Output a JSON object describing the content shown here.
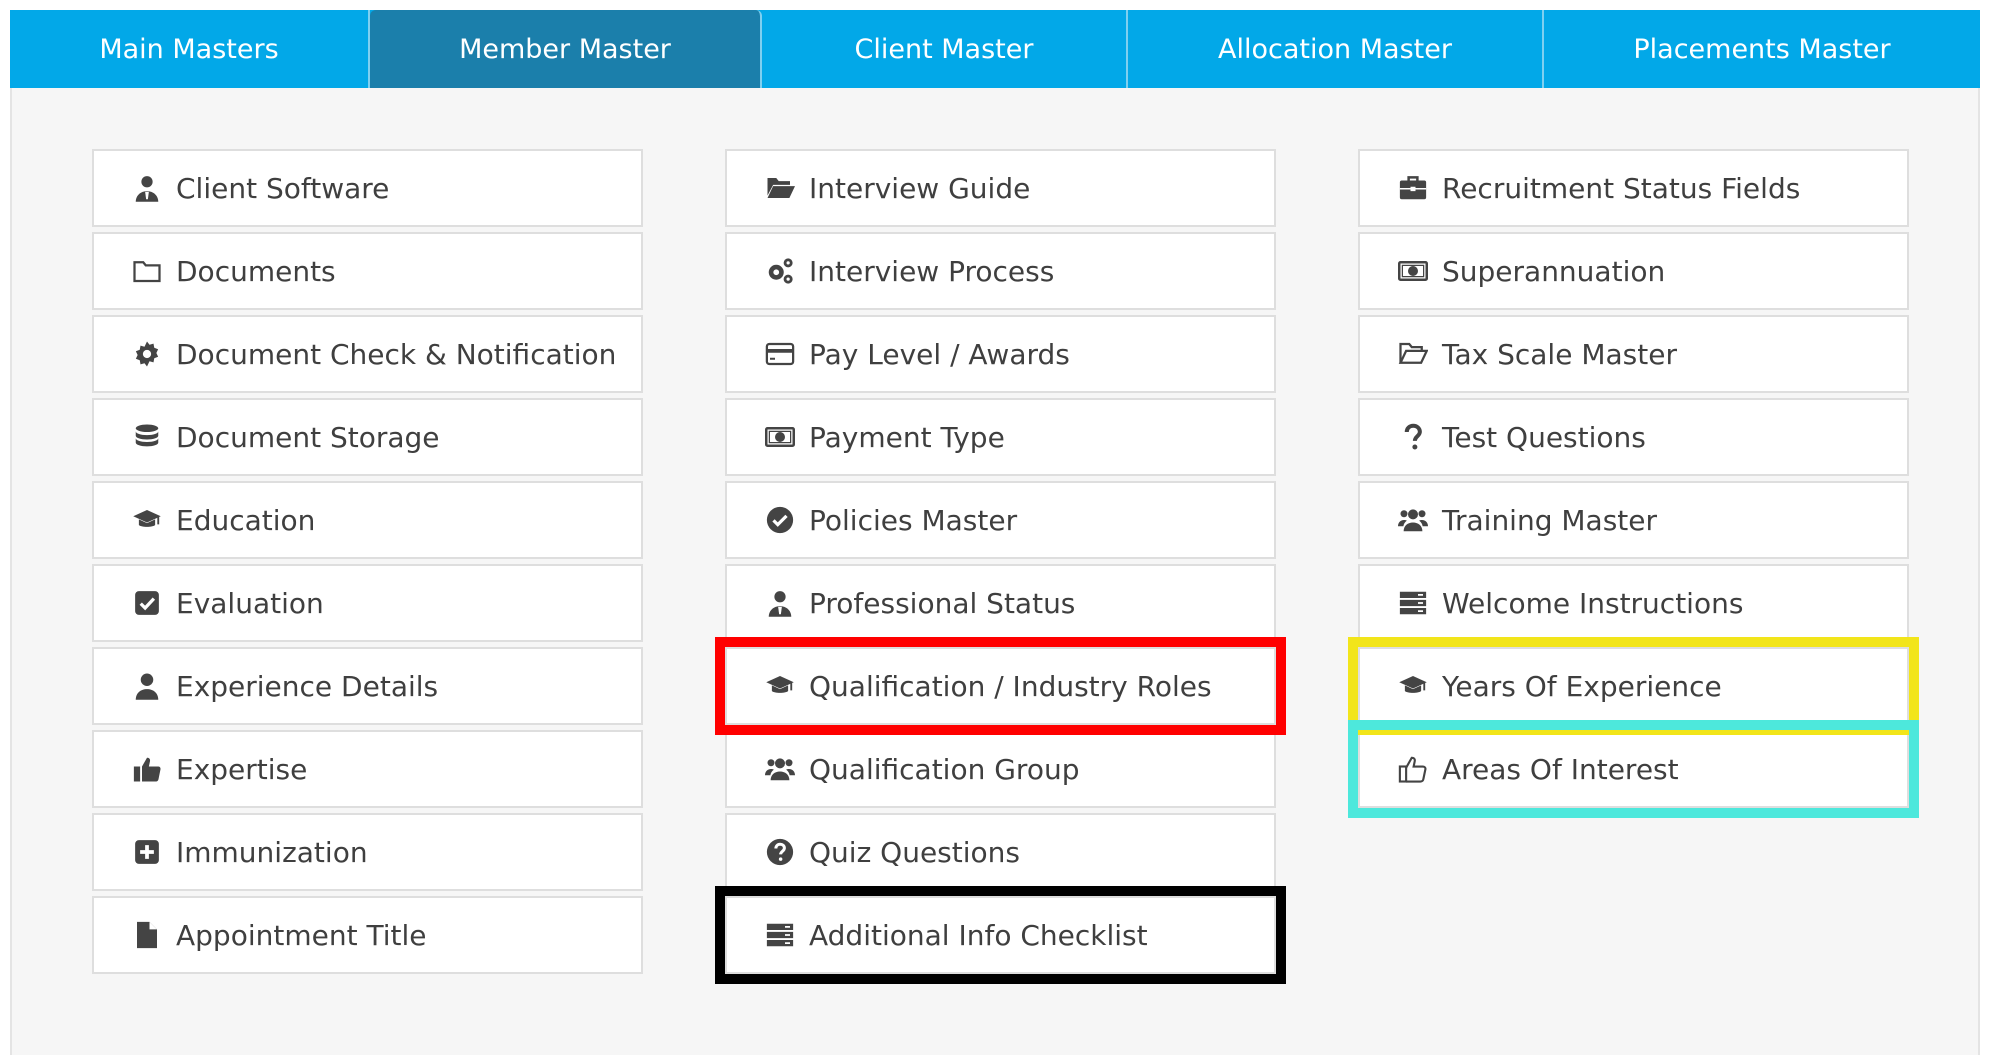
{
  "tabs": [
    {
      "label": "Main Masters",
      "active": false
    },
    {
      "label": "Member Master",
      "active": true
    },
    {
      "label": "Client Master",
      "active": false
    },
    {
      "label": "Allocation Master",
      "active": false
    },
    {
      "label": "Placements Master",
      "active": false
    }
  ],
  "columns": [
    [
      {
        "label": "Client Software",
        "icon": "user-tie-icon"
      },
      {
        "label": "Documents",
        "icon": "folder-icon"
      },
      {
        "label": "Document Check & Notification",
        "icon": "gear-icon"
      },
      {
        "label": "Document Storage",
        "icon": "database-icon"
      },
      {
        "label": "Education",
        "icon": "graduation-cap-icon"
      },
      {
        "label": "Evaluation",
        "icon": "checkbox-icon"
      },
      {
        "label": "Experience Details",
        "icon": "user-icon"
      },
      {
        "label": "Expertise",
        "icon": "thumbs-up-icon"
      },
      {
        "label": "Immunization",
        "icon": "plus-square-icon"
      },
      {
        "label": "Appointment Title",
        "icon": "file-icon"
      }
    ],
    [
      {
        "label": "Interview Guide",
        "icon": "folder-open-icon"
      },
      {
        "label": "Interview Process",
        "icon": "gears-icon"
      },
      {
        "label": "Pay Level / Awards",
        "icon": "credit-card-icon"
      },
      {
        "label": "Payment Type",
        "icon": "money-icon"
      },
      {
        "label": "Policies Master",
        "icon": "check-circle-icon"
      },
      {
        "label": "Professional Status",
        "icon": "user-tie-icon"
      },
      {
        "label": "Qualification / Industry Roles",
        "icon": "graduation-cap-icon"
      },
      {
        "label": "Qualification Group",
        "icon": "users-icon"
      },
      {
        "label": "Quiz Questions",
        "icon": "question-circle-icon"
      },
      {
        "label": "Additional Info Checklist",
        "icon": "server-icon"
      }
    ],
    [
      {
        "label": "Recruitment Status Fields",
        "icon": "briefcase-icon"
      },
      {
        "label": "Superannuation",
        "icon": "money-icon"
      },
      {
        "label": "Tax Scale Master",
        "icon": "folder-open-outline-icon"
      },
      {
        "label": "Test Questions",
        "icon": "question-icon"
      },
      {
        "label": "Training Master",
        "icon": "users-icon"
      },
      {
        "label": "Welcome Instructions",
        "icon": "server-icon"
      },
      {
        "label": "Years Of Experience",
        "icon": "graduation-cap-icon"
      },
      {
        "label": "Areas Of Interest",
        "icon": "thumbs-up-outline-icon"
      }
    ]
  ],
  "highlights": [
    {
      "target": "Qualification / Industry Roles",
      "color": "#ff0000"
    },
    {
      "target": "Additional Info Checklist",
      "color": "#000000"
    },
    {
      "target": "Years Of Experience",
      "color": "#f2e51a"
    },
    {
      "target": "Areas Of Interest",
      "color": "#4de8dc"
    }
  ],
  "colors": {
    "tab_bar": "#02a8e8",
    "tab_active": "#1b7fab"
  }
}
